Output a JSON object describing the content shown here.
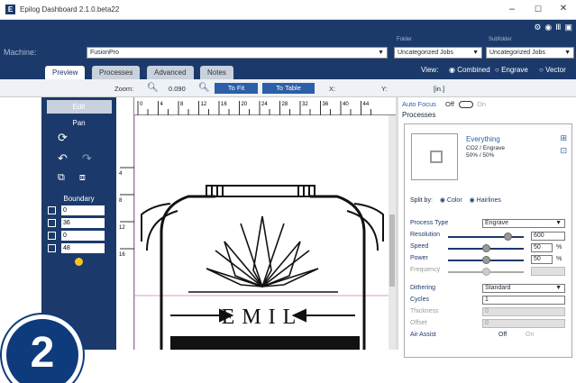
{
  "window": {
    "title": "Epilog Dashboard 2.1.0.beta22",
    "minimize": "–",
    "maximize": "☐",
    "close": "✕"
  },
  "machine": {
    "label": "Machine:",
    "value": "FusionPro",
    "folder_label": "Folder",
    "folder_value": "Uncategorized Jobs",
    "subfolder_label": "Subfolder",
    "subfolder_value": "Uncategorized Jobs"
  },
  "tabs": [
    {
      "label": "Preview"
    },
    {
      "label": "Processes"
    },
    {
      "label": "Advanced"
    },
    {
      "label": "Notes"
    }
  ],
  "view": {
    "label": "View:",
    "options": [
      "Combined",
      "Engrave",
      "Vector"
    ],
    "selected": "Combined"
  },
  "zoom": {
    "label": "Zoom:",
    "value": "0.090",
    "fit_label": "To Fit",
    "table_label": "To Table",
    "x_label": "X:",
    "y_label": "Y:",
    "unit": "[in.]"
  },
  "toolbar": {
    "edit_label": "Edit",
    "pan_label": "Pan",
    "boundary_label": "Boundary",
    "boundary_values": [
      "0",
      "36",
      "0",
      "48"
    ]
  },
  "ruler": {
    "top_ticks": [
      "0",
      "4",
      "8",
      "12",
      "16",
      "20",
      "24",
      "28",
      "32",
      "36",
      "40",
      "44"
    ],
    "left_ticks": [
      "4",
      "8",
      "12",
      "16"
    ]
  },
  "artwork": {
    "text": "EMIL"
  },
  "panel": {
    "autofocus_label": "Auto Focus",
    "autofocus_state": "Off",
    "autofocus_on": "On",
    "processes_title": "Processes",
    "process_name": "Everything",
    "process_type_line": "CO2 / Engrave",
    "process_params": "50% / 50%",
    "split_by_label": "Split by:",
    "split_color": "Color",
    "split_hairlines": "Hairlines",
    "process_type_label": "Process Type",
    "process_type_value": "Engrave",
    "resolution_label": "Resolution",
    "resolution_value": "600",
    "speed_label": "Speed",
    "speed_value": "50",
    "speed_unit": "%",
    "power_label": "Power",
    "power_value": "50",
    "power_unit": "%",
    "frequency_label": "Frequency",
    "dithering_label": "Dithering",
    "dithering_value": "Standard",
    "cycles_label": "Cycles",
    "cycles_value": "1",
    "thickness_label": "Thickness",
    "thickness_value": "0",
    "offset_label": "Offset",
    "offset_value": "0",
    "airassist_label": "Air Assist",
    "airassist_state": "Off",
    "airassist_on": "On"
  },
  "step_badge": "2",
  "colors": {
    "navy": "#1b3a6b",
    "accent": "#2b5fa8",
    "badge": "#0e3b7c"
  }
}
